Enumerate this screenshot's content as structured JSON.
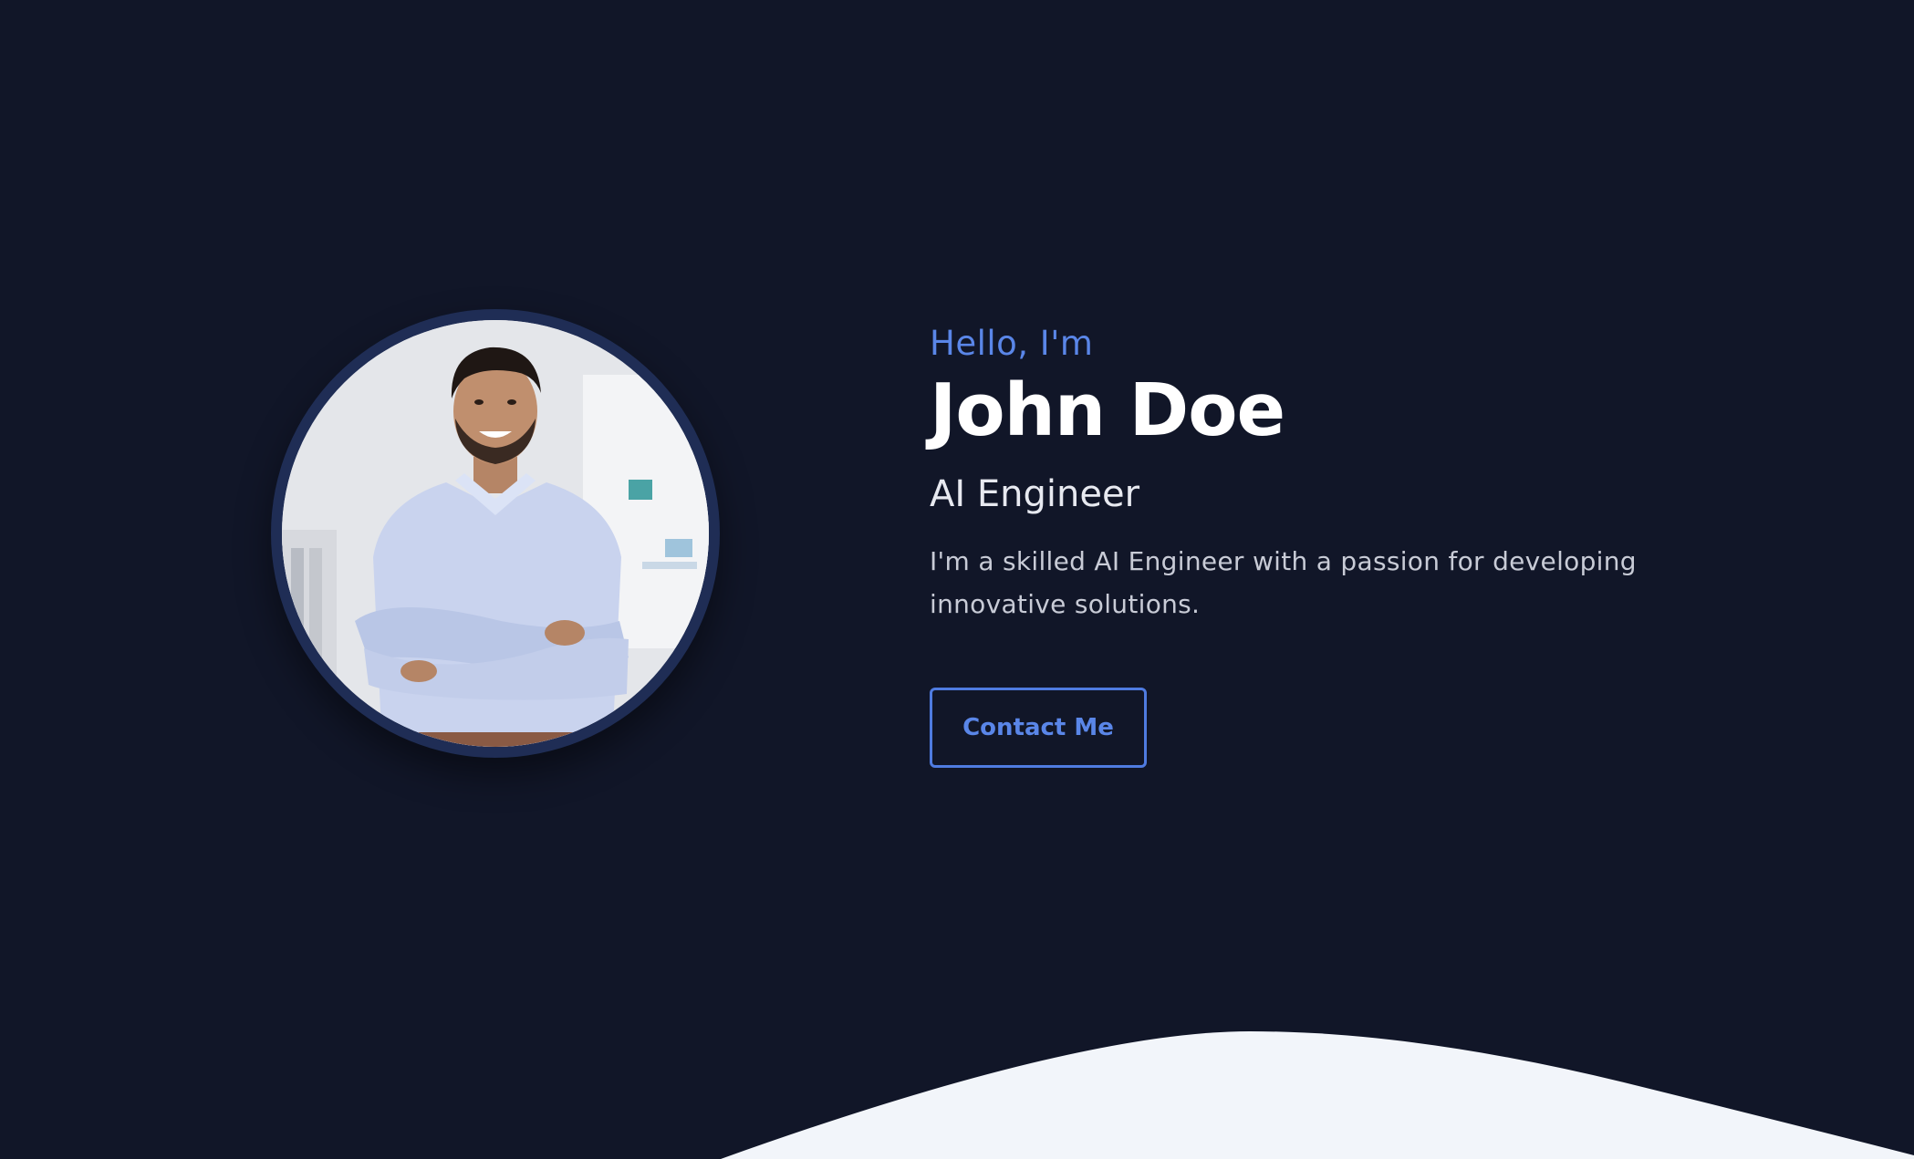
{
  "hero": {
    "greeting": "Hello, I'm",
    "name": "John Doe",
    "role": "AI Engineer",
    "bio": "I'm a skilled AI Engineer with a passion for developing innovative solutions.",
    "contact_label": "Contact Me"
  },
  "colors": {
    "background": "#111628",
    "accent": "#5a86e8",
    "wave": "#f2f5fa",
    "avatar_ring": "#1f2d55"
  }
}
